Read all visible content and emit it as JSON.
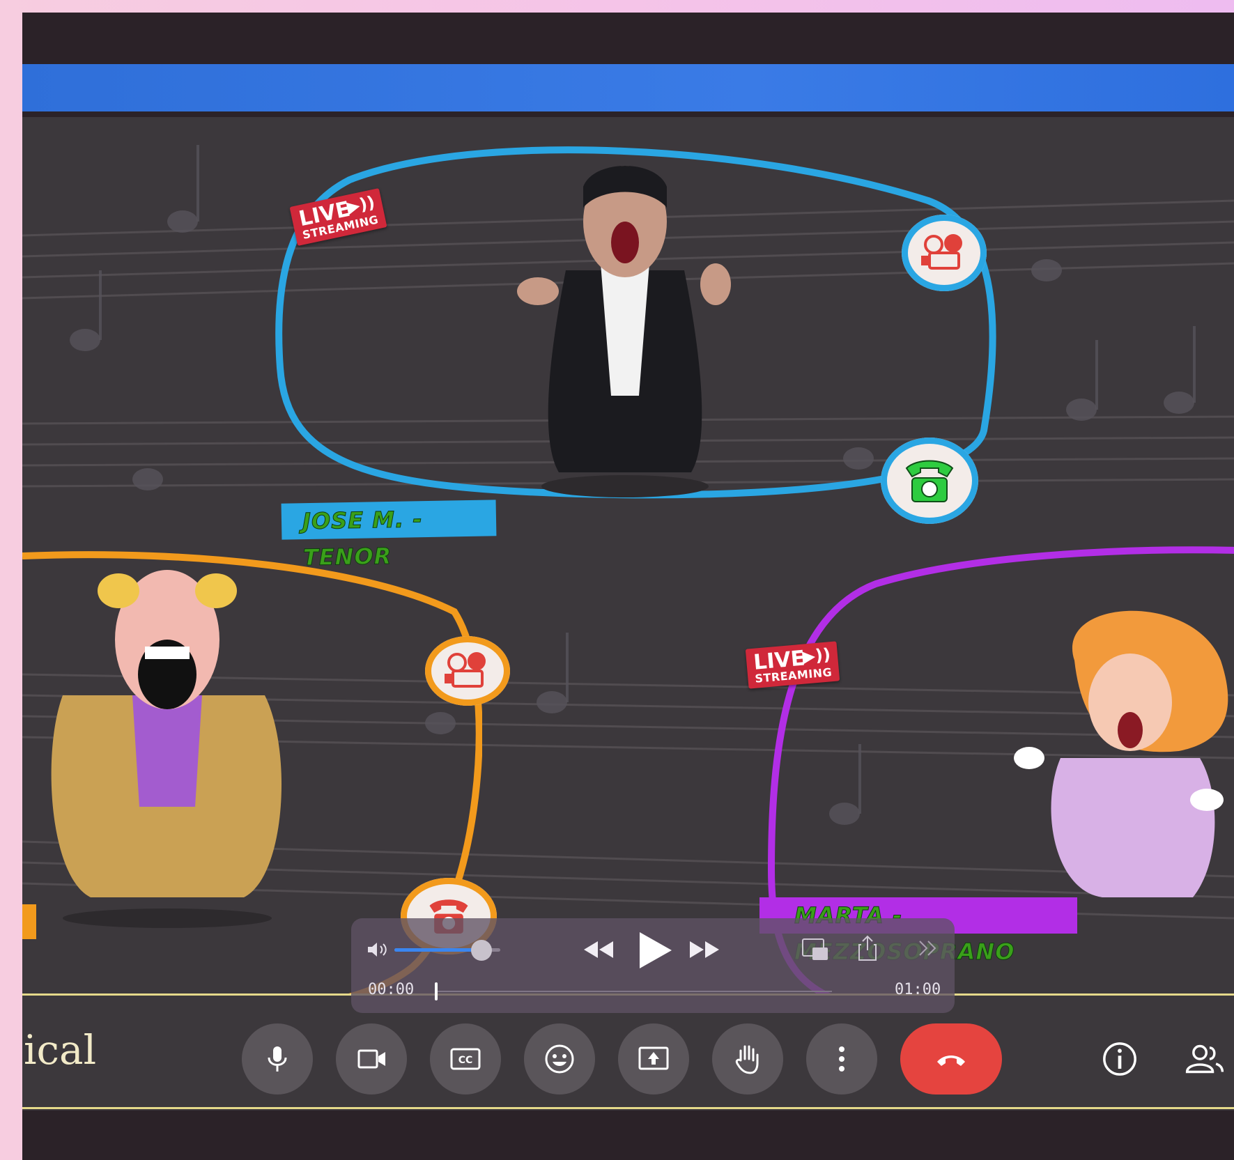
{
  "colors": {
    "stage_bg": "#3c383c",
    "header_blue": "#3a7be6",
    "tenor_frame": "#2aa6e3",
    "baritone_frame": "#f29a1c",
    "mezzo_frame": "#b22ee6",
    "live_badge": "#d0283a",
    "leave_button": "#e5443f"
  },
  "participants": [
    {
      "name_tag": "JOSE M. - TENOR",
      "live_badge": {
        "main": "LIVE",
        "sub": "STREAMING"
      },
      "icons": [
        "film-camera-icon",
        "green-telephone-icon"
      ]
    },
    {
      "name_tag": "",
      "live_badge": null,
      "icons": [
        "film-camera-icon",
        "red-telephone-icon"
      ]
    },
    {
      "name_tag": "MARTA - MEZZOSOPRANO",
      "live_badge": {
        "main": "LIVE",
        "sub": "STREAMING"
      },
      "icons": []
    }
  ],
  "player": {
    "volume_level": 0.82,
    "time_current": "00:00",
    "time_total": "01:00",
    "progress": 0.0,
    "icons": [
      "volume-icon",
      "rewind-icon",
      "play-icon",
      "fast-forward-icon",
      "picture-in-picture-icon",
      "share-icon",
      "more-chevrons-icon"
    ]
  },
  "meeting_bar": {
    "meeting_name": "ical",
    "controls": [
      "microphone-icon",
      "camera-icon",
      "captions-icon",
      "emoji-icon",
      "present-screen-icon",
      "raise-hand-icon",
      "more-options-icon",
      "hang-up-icon"
    ],
    "right_icons": [
      "info-icon",
      "people-icon"
    ]
  }
}
